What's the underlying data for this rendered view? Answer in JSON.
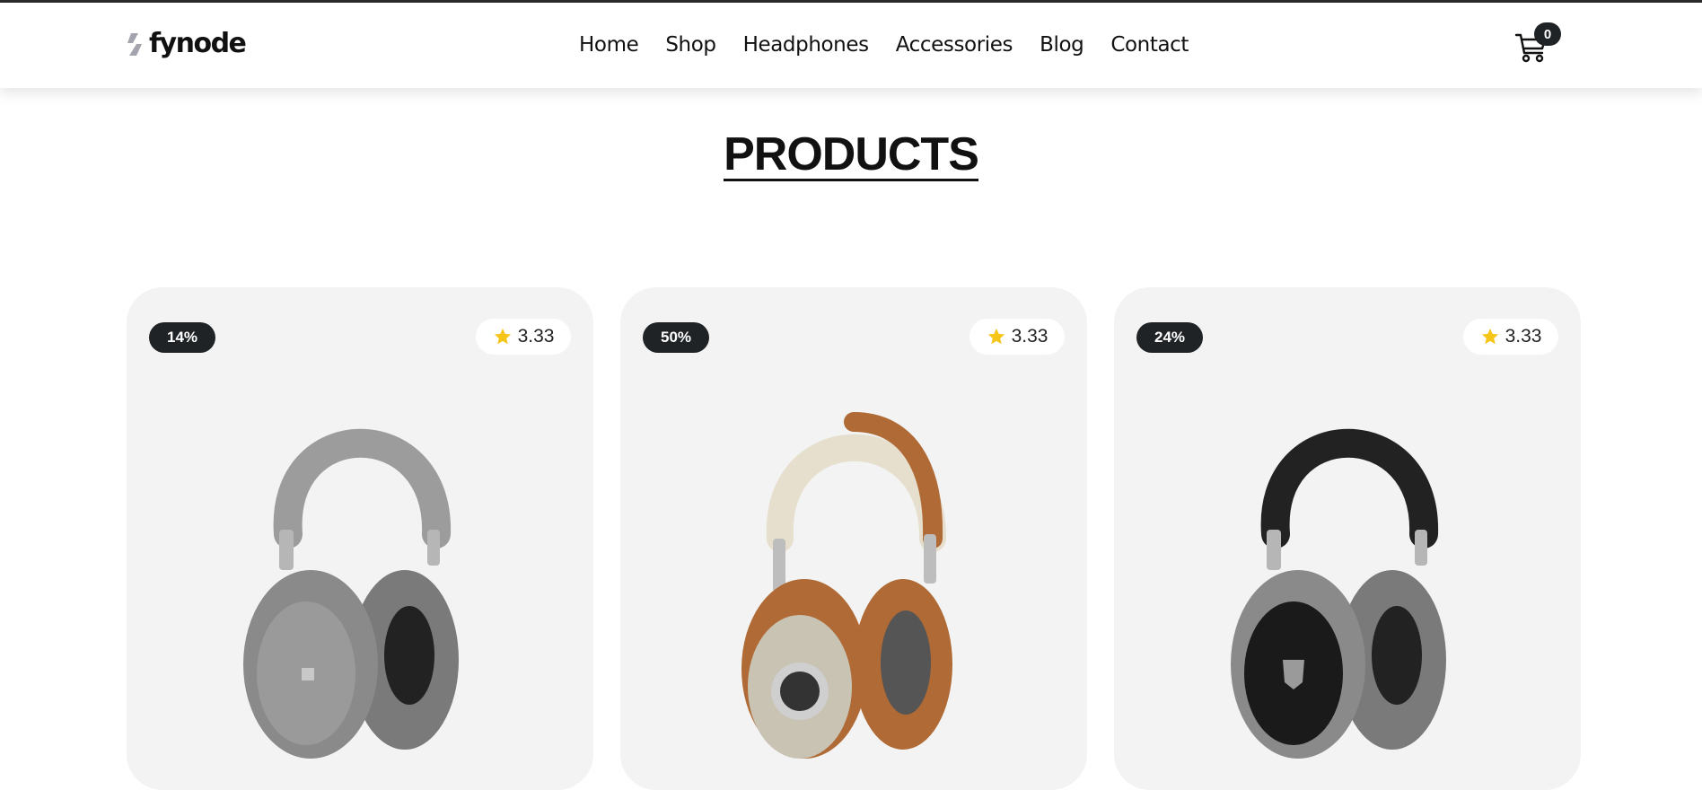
{
  "brand": {
    "name": "fynode",
    "colors": {
      "mark": "#a4a4ae",
      "text": "#111111"
    }
  },
  "nav": {
    "items": [
      {
        "label": "Home"
      },
      {
        "label": "Shop"
      },
      {
        "label": "Headphones"
      },
      {
        "label": "Accessories"
      },
      {
        "label": "Blog"
      },
      {
        "label": "Contact"
      }
    ]
  },
  "cart": {
    "icon": "cart-icon",
    "count": "0"
  },
  "page": {
    "title": "PRODUCTS"
  },
  "products": [
    {
      "discount": "14%",
      "rating": "3.33",
      "colors": {
        "band": "#9c9c9c",
        "cup": "#8a8a8a",
        "cushion": "#7a7a7a",
        "plate": "#9a9a9a"
      }
    },
    {
      "discount": "50%",
      "rating": "3.33",
      "colors": {
        "band": "#e6dfcd",
        "cup": "#c9c3b4",
        "cushion": "#b06a35",
        "plate": "#cfcfcf"
      }
    },
    {
      "discount": "24%",
      "rating": "3.33",
      "colors": {
        "band": "#222222",
        "cup": "#8a8a8a",
        "cushion": "#7a7a7a",
        "plate": "#1a1a1a"
      }
    }
  ],
  "accent": {
    "star": "#f5c518",
    "badge": "#1f2326"
  }
}
